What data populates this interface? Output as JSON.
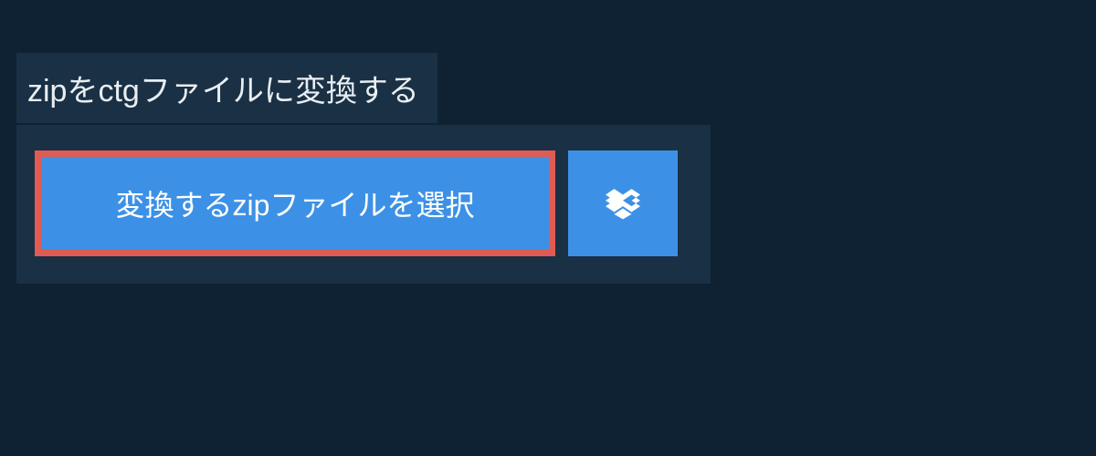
{
  "header": {
    "title": "zipをctgファイルに変換する"
  },
  "upload": {
    "select_button_label": "変換するzipファイルを選択",
    "dropbox_icon_name": "dropbox-icon"
  },
  "colors": {
    "background": "#0f2233",
    "panel": "#1a3044",
    "button_primary": "#3c91e6",
    "button_border_highlight": "#e05b54",
    "text_light": "#e8eef3",
    "text_white": "#ffffff"
  }
}
